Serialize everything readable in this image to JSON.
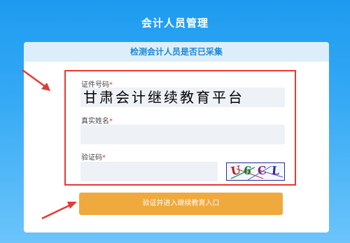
{
  "page": {
    "title": "会计人员管理"
  },
  "card": {
    "header": "检测会计人员是否已采集"
  },
  "form": {
    "id_label": "证件号码",
    "id_value": "甘肃会计继续教育平台",
    "name_label": "真实姓名",
    "name_value": "",
    "captcha_label": "验证码",
    "captcha_value": "",
    "required_mark": "*",
    "captcha_chars": [
      "U",
      "6",
      "C",
      "L"
    ]
  },
  "submit": {
    "label": "验证并进入继续教育入口"
  },
  "colors": {
    "background": "#1d9bf0",
    "header_text": "#1e88d6",
    "highlight_border": "#e53935",
    "button": "#f0a93c"
  }
}
